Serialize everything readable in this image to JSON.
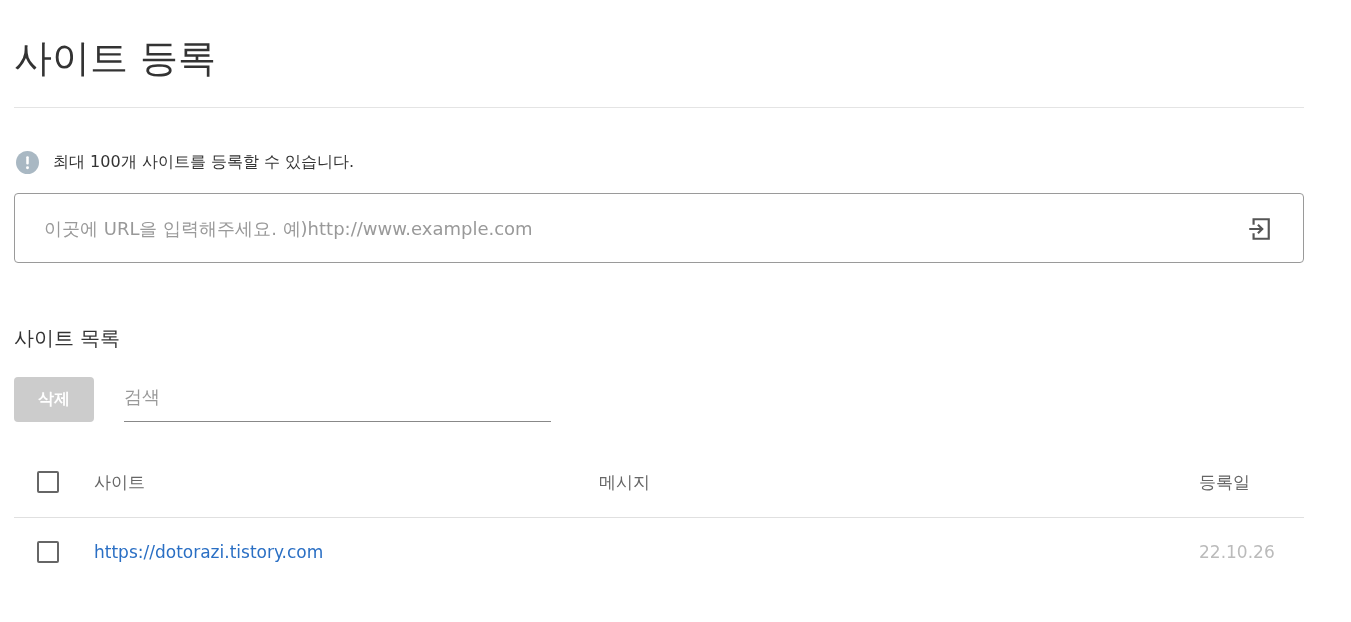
{
  "page": {
    "title": "사이트 등록"
  },
  "notice": {
    "text": "최대 100개 사이트를 등록할 수 있습니다."
  },
  "url_input": {
    "placeholder": "이곳에 URL을 입력해주세요. 예)http://www.example.com"
  },
  "site_list": {
    "heading": "사이트 목록",
    "delete_button": {
      "label": "삭제",
      "disabled": true
    },
    "search": {
      "placeholder": "검색"
    },
    "table": {
      "select_all": {
        "checked": false
      },
      "columns": [
        "사이트",
        "메시지",
        "등록일"
      ],
      "rows": [
        {
          "checked": false,
          "site": "https://dotorazi.tistory.com",
          "date": "22.10.26"
        }
      ]
    }
  }
}
